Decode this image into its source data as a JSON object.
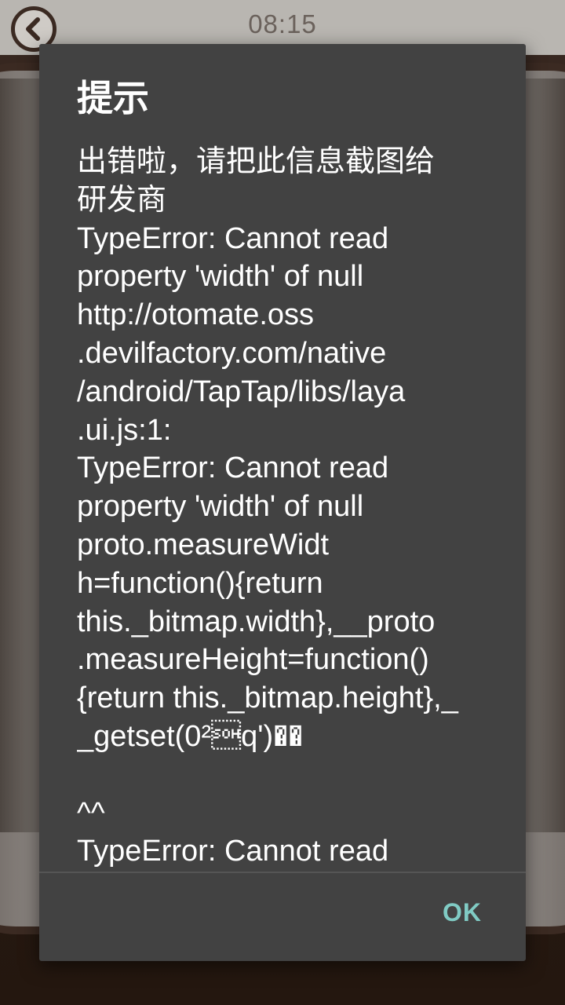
{
  "status": {
    "clock": "08:15"
  },
  "dialog": {
    "title": "提示",
    "message_lines": [
      "出错啦，请把此信息截图给",
      "研发商",
      "TypeError: Cannot read",
      "property 'width' of null",
      "http://otomate.oss",
      ".devilfactory.com/native",
      "/android/TapTap/libs/laya",
      ".ui.js:1:",
      "TypeError: Cannot read",
      "property 'width' of null",
      "proto.measureWidt",
      "h=function(){return",
      "this._bitmap.width},__proto",
      ".measureHeight=function()",
      "{return this._bitmap.height},_",
      "_getset(0²\u0001q')��",
      "",
      "^^",
      "TypeError: Cannot read"
    ],
    "ok_label": "OK"
  },
  "icons": {
    "back": "chevron-left-icon"
  },
  "colors": {
    "dialog_bg": "#424242",
    "accent": "#80cbc4"
  }
}
